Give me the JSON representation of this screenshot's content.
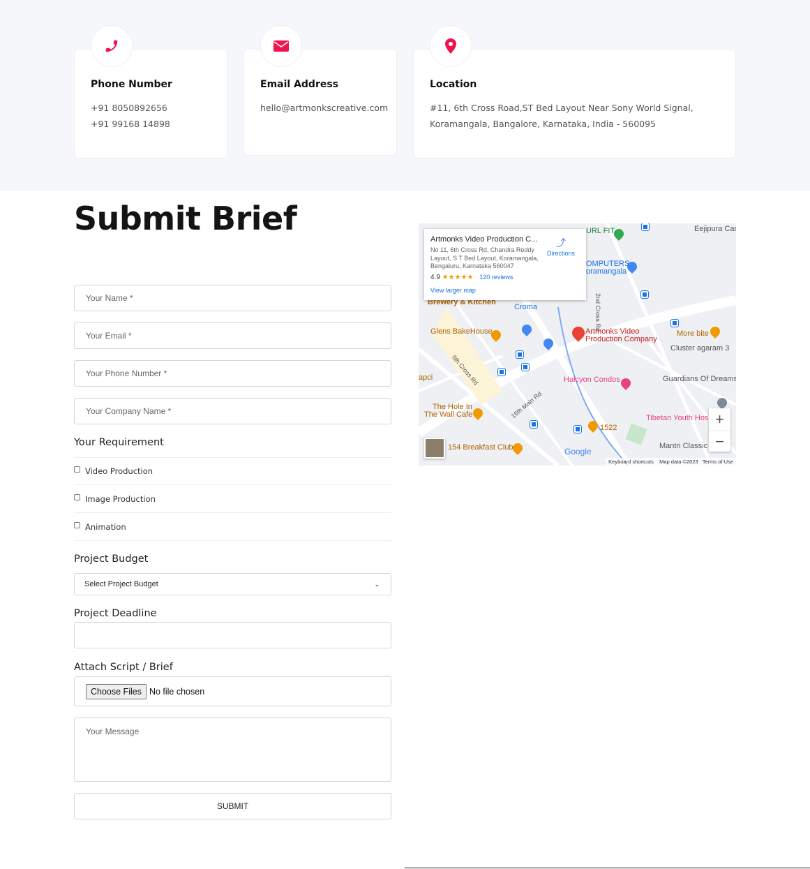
{
  "contact": {
    "phone": {
      "title": "Phone Number",
      "lines": [
        "+91 8050892656",
        "+91 99168 14898"
      ],
      "icon": "phone-icon"
    },
    "email": {
      "title": "Email Address",
      "lines": [
        "hello@artmonkscreative.com"
      ],
      "icon": "envelope-icon"
    },
    "location": {
      "title": "Location",
      "lines": [
        "#11, 6th Cross Road,ST Bed Layout Near Sony World Signal,",
        "Koramangala, Bangalore, Karnataka, India - 560095"
      ],
      "icon": "map-pin-icon"
    },
    "accent": "#f0134d"
  },
  "form": {
    "title": "Submit Brief",
    "name_placeholder": "Your Name *",
    "email_placeholder": "Your Email *",
    "phone_placeholder": "Your Phone Number *",
    "company_placeholder": "Your Company Name *",
    "requirement_label": "Your Requirement",
    "requirements": [
      "Video Production",
      "Image Production",
      "Animation"
    ],
    "budget_label": "Project Budget",
    "budget_selected": "Select Project Budget",
    "deadline_label": "Project Deadline",
    "attach_label": "Attach Script / Brief",
    "choose_files": "Choose Files",
    "no_file": "No file chosen",
    "message_placeholder": "Your Message",
    "submit": "SUBMIT"
  },
  "map": {
    "card": {
      "title": "Artmonks Video Production C...",
      "address": [
        "No 11, 6th Cross Rd, Chandra Reddy",
        "Layout, S T Bed Layout, Koramangala,",
        "Bengaluru, Karnataka 560047"
      ],
      "rating": "4.9",
      "stars": "★★★★★",
      "reviews": "120 reviews",
      "directions": "Directions",
      "larger": "View larger map"
    },
    "labels": [
      "Artmonks Video",
      "Production Company",
      "Brewery & Kitchen",
      "Croma",
      "Glens BakeHouse",
      "6th Cross Rd",
      "The Hole In",
      "The Wall Cafe",
      "16th Main Rd",
      "Halcyon Condos",
      "1522",
      "154 Breakfast Club",
      "Guardians Of Dreams",
      "Tibetan Youth Hos",
      "Mantri Classic",
      "More bite",
      "Cluster agaram 3",
      "OMPUTERS",
      "oramangala",
      "URL FIT",
      "Eejipura Can",
      "2nd Cross Rd",
      "apci"
    ],
    "google": "Google",
    "footer": [
      "Keyboard shortcuts",
      "Map data ©2023",
      "Terms of Use"
    ],
    "zoom_in": "+",
    "zoom_out": "−"
  }
}
